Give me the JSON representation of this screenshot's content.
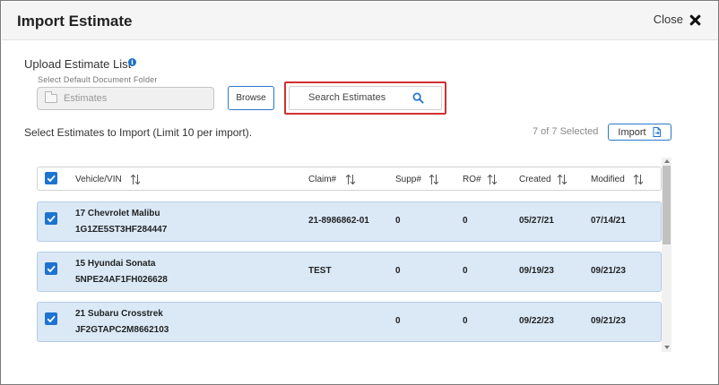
{
  "dialog": {
    "title": "Import Estimate",
    "close_label": "Close"
  },
  "upload": {
    "label": "Upload Estimate List",
    "folder_caption": "Select Default Document Folder",
    "folder_value": "Estimates",
    "browse_label": "Browse",
    "search_label": "Search Estimates"
  },
  "selection": {
    "instruction": "Select Estimates to Import (Limit 10 per import).",
    "count_text": "7 of 7 Selected",
    "import_label": "Import",
    "all_checked": true
  },
  "table": {
    "headers": {
      "vehicle": "Vehicle/VIN",
      "claim": "Claim#",
      "supp": "Supp#",
      "ro": "RO#",
      "created": "Created",
      "modified": "Modified"
    },
    "rows": [
      {
        "vehicle": "17 Chevrolet Malibu",
        "vin": "1G1ZE5ST3HF284447",
        "claim": "21-8986862-01",
        "supp": "0",
        "ro": "0",
        "created": "05/27/21",
        "modified": "07/14/21",
        "checked": true
      },
      {
        "vehicle": "15 Hyundai Sonata",
        "vin": "5NPE24AF1FH026628",
        "claim": "TEST",
        "supp": "0",
        "ro": "0",
        "created": "09/19/23",
        "modified": "09/21/23",
        "checked": true
      },
      {
        "vehicle": "21 Subaru Crosstrek",
        "vin": "JF2GTAPC2M8662103",
        "claim": "",
        "supp": "0",
        "ro": "0",
        "created": "09/22/23",
        "modified": "09/21/23",
        "checked": true
      }
    ]
  },
  "colors": {
    "accent": "#1e73d0",
    "row_selected_bg": "#dbe9f7",
    "highlight_border": "#d23030"
  },
  "icons": {
    "info": "info-icon",
    "close": "close-icon",
    "folder": "folder-icon",
    "search": "search-icon",
    "sort": "sort-icon",
    "import": "document-export-icon",
    "checkbox": "checkbox-checked-icon"
  }
}
